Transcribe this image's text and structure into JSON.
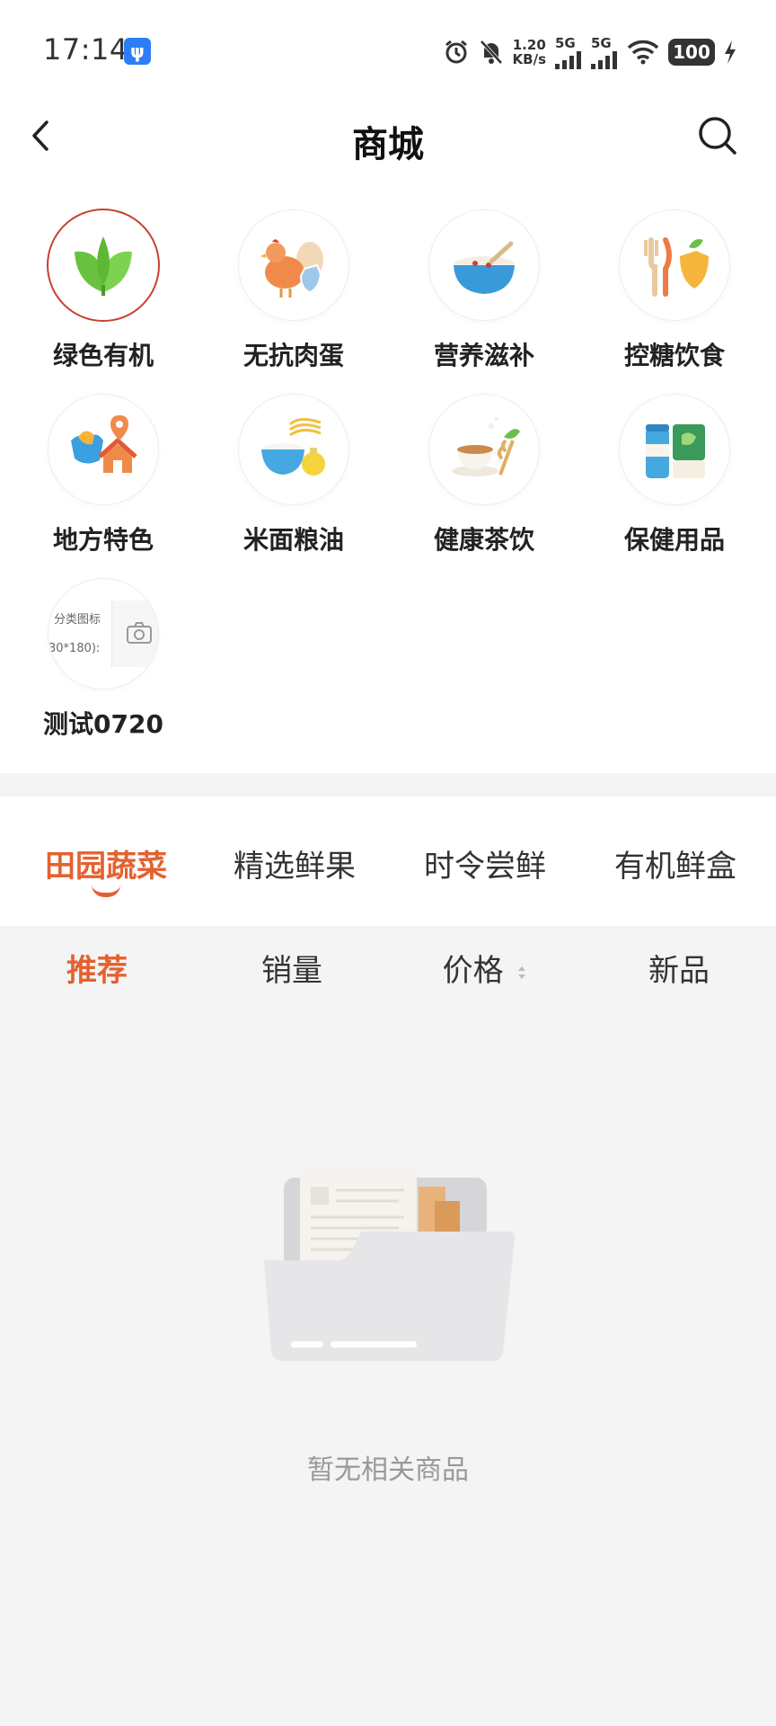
{
  "status_bar": {
    "time": "17:14",
    "net_speed_value": "1.20",
    "net_speed_unit": "KB/s",
    "signal1_label": "5G",
    "signal2_label": "5G",
    "battery": "100"
  },
  "header": {
    "title": "商城"
  },
  "categories": [
    {
      "label": "绿色有机",
      "icon": "leaf-icon",
      "selected": true
    },
    {
      "label": "无抗肉蛋",
      "icon": "chicken-egg-icon"
    },
    {
      "label": "营养滋补",
      "icon": "porridge-bowl-icon"
    },
    {
      "label": "控糖饮食",
      "icon": "fork-knife-shield-icon"
    },
    {
      "label": "地方特色",
      "icon": "map-house-icon"
    },
    {
      "label": "米面粮油",
      "icon": "rice-noodle-oil-icon"
    },
    {
      "label": "健康茶饮",
      "icon": "tea-cup-icon"
    },
    {
      "label": "保健用品",
      "icon": "health-products-icon"
    },
    {
      "label": "测试0720",
      "icon": "placeholder-upload-icon",
      "placeholder_text1": "分类图标",
      "placeholder_text2": "30*180):"
    }
  ],
  "product_tabs": [
    {
      "label": "田园蔬菜",
      "active": true
    },
    {
      "label": "精选鲜果"
    },
    {
      "label": "时令尝鲜"
    },
    {
      "label": "有机鲜盒"
    }
  ],
  "sort_options": [
    {
      "label": "推荐",
      "active": true
    },
    {
      "label": "销量"
    },
    {
      "label": "价格"
    },
    {
      "label": "新品"
    }
  ],
  "empty_state": {
    "text": "暂无相关商品",
    "icon": "empty-folder-icon"
  },
  "colors": {
    "accent": "#e5602f",
    "selected_ring": "#c8402f",
    "background": "#f4f4f4"
  }
}
